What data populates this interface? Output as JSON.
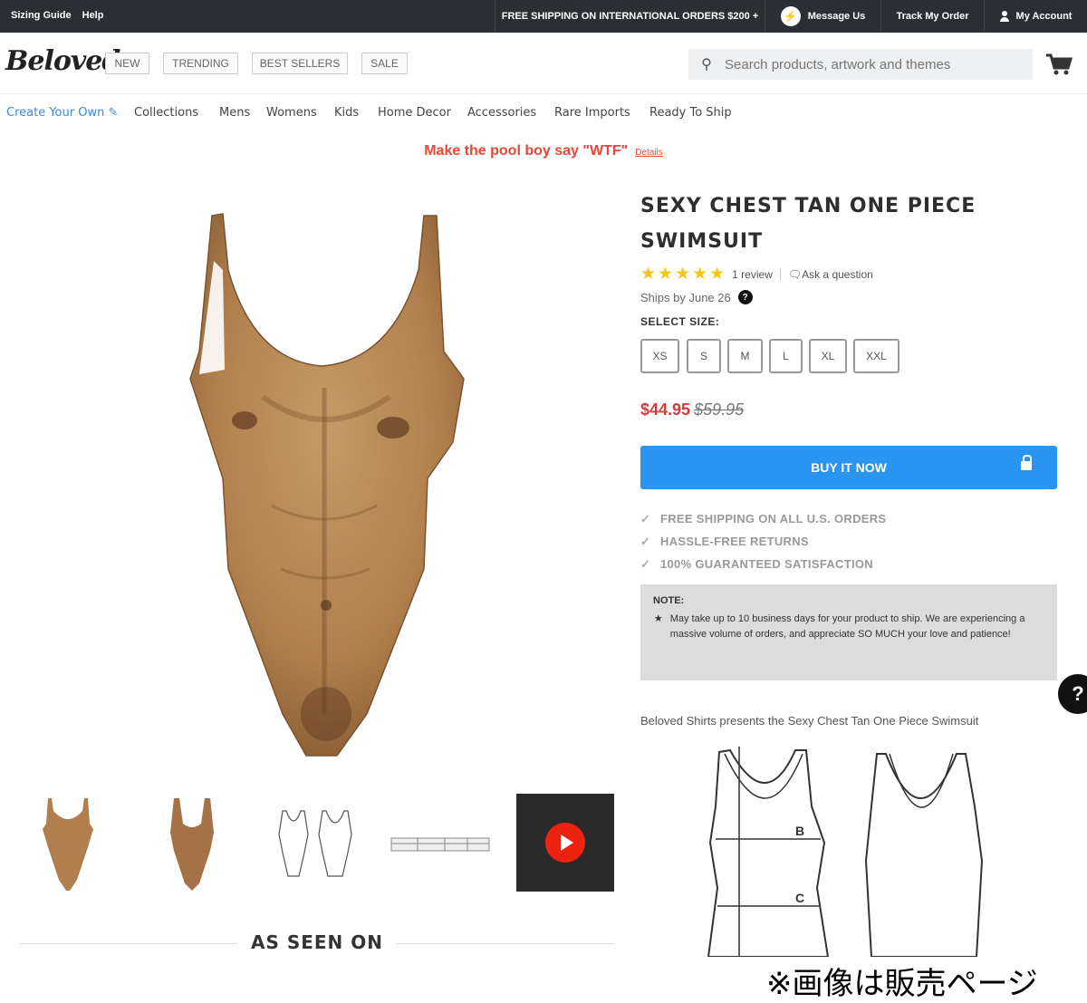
{
  "topbar": {
    "sizing_guide": "Sizing Guide",
    "help": "Help",
    "shipping": "FREE SHIPPING ON INTERNATIONAL ORDERS $200 +",
    "message_us": "Message Us",
    "track_order": "Track My Order",
    "my_account": "My Account"
  },
  "header": {
    "logo": "Beloved",
    "nav": [
      "NEW",
      "TRENDING",
      "BEST SELLERS",
      "SALE"
    ],
    "search_placeholder": "Search products, artwork and themes"
  },
  "categories": [
    "Create Your Own ✎",
    "Collections",
    "Mens",
    "Womens",
    "Kids",
    "Home Decor",
    "Accessories",
    "Rare Imports",
    "Ready To Ship"
  ],
  "promo": {
    "text": "Make the pool boy say \"WTF\"",
    "details": "Details"
  },
  "product": {
    "title": "SEXY CHEST TAN ONE PIECE SWIMSUIT",
    "rating": 5,
    "stars": "★★★★★",
    "review_count": "1 review",
    "ask": "Ask a question",
    "ships": "Ships by June 26",
    "select_size_label": "SELECT SIZE:",
    "sizes": [
      "XS",
      "S",
      "M",
      "L",
      "XL",
      "XXL"
    ],
    "price": "$44.95",
    "old_price": "$59.95",
    "buy_label": "BUY IT NOW",
    "perks": [
      "FREE SHIPPING ON ALL U.S. ORDERS",
      "HASSLE-FREE RETURNS",
      "100% GUARANTEED SATISFACTION"
    ],
    "note_heading": "NOTE:",
    "note_text": "May take up to 10 business days for your product to ship. We are experiencing a massive volume of orders, and appreciate SO MUCH your love and patience!",
    "presents": "Beloved Shirts presents the Sexy Chest Tan One Piece Swimsuit",
    "diagram_labels": [
      "B",
      "C"
    ]
  },
  "as_seen_on": "AS SEEN ON",
  "caption": "※画像は販売ページ",
  "colors": {
    "accent": "#2a95f0",
    "sale": "#d63a3a",
    "promo": "#e43",
    "topbar": "#2b2f33",
    "stars": "#f5c518"
  }
}
